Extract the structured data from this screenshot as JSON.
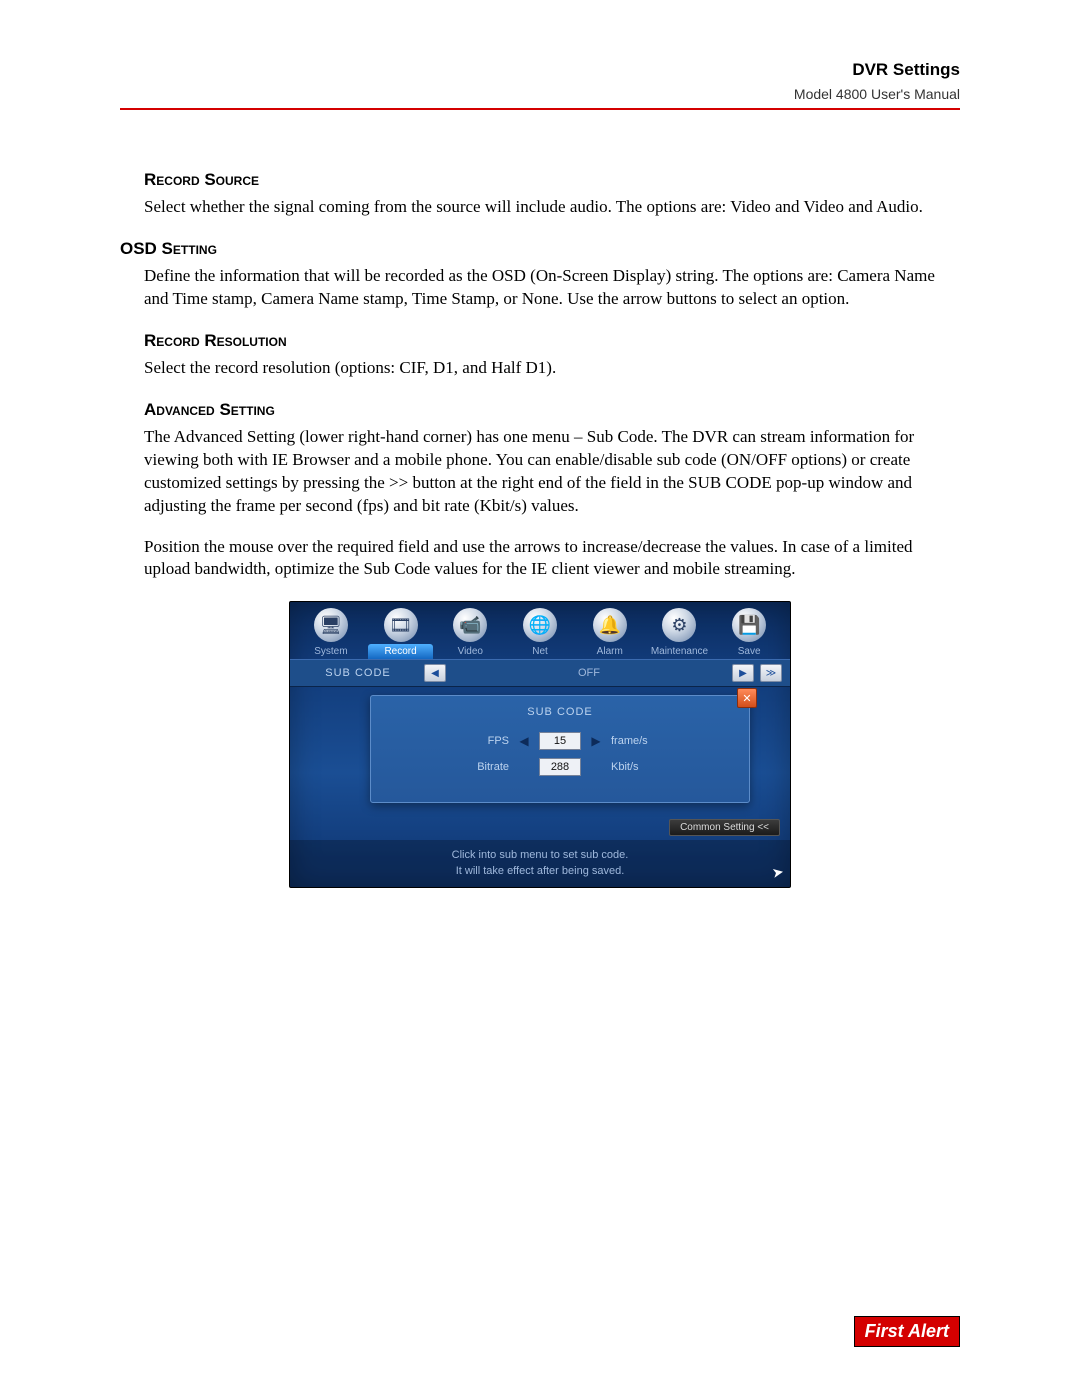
{
  "header": {
    "title": "DVR Settings",
    "subtitle": "Model 4800 User's Manual"
  },
  "sections": {
    "record_source": {
      "heading": "Record Source",
      "body": "Select whether the signal coming from the source will include audio. The options are: Video and Video and Audio."
    },
    "osd": {
      "heading": "OSD Setting",
      "body": "Define the information that will be recorded as the OSD (On-Screen Display) string. The options are: Camera Name and Time stamp, Camera Name stamp, Time Stamp, or None. Use the arrow buttons to select an option."
    },
    "record_resolution": {
      "heading": "Record Resolution",
      "body": "Select the record resolution (options: CIF, D1, and Half D1)."
    },
    "advanced": {
      "heading": "Advanced Setting",
      "body1": "The Advanced Setting (lower right-hand corner) has one menu – Sub Code. The DVR can stream information for viewing both with IE Browser and a mobile phone. You can enable/disable sub code (ON/OFF options) or create customized settings by pressing the >> button at the right end of the field in the SUB CODE pop-up window and adjusting the frame per second (fps) and bit rate (Kbit/s) values.",
      "body2": "Position the mouse over the required field and use the arrows to increase/decrease the values. In case of a limited upload bandwidth, optimize the Sub Code values for the IE client viewer and mobile streaming."
    }
  },
  "dvr": {
    "tabs": [
      "System",
      "Record",
      "Video",
      "Net",
      "Alarm",
      "Maintenance",
      "Save"
    ],
    "active_tab": "Record",
    "sub_code_label": "SUB CODE",
    "sub_code_value": "OFF",
    "popup": {
      "title": "SUB CODE",
      "fps_label": "FPS",
      "fps_value": "15",
      "fps_unit": "frame/s",
      "bitrate_label": "Bitrate",
      "bitrate_value": "288",
      "bitrate_unit": "Kbit/s"
    },
    "common_button": "Common Setting <<",
    "hint1": "Click into sub menu to set sub code.",
    "hint2": "It will take effect after being saved."
  },
  "brand": "First Alert"
}
